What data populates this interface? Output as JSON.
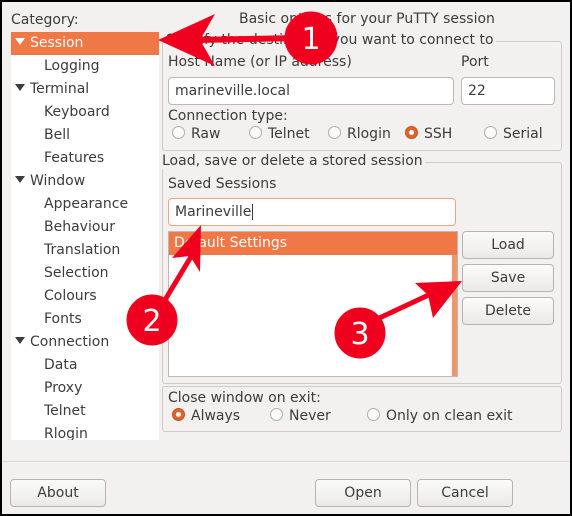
{
  "category": {
    "label": "Category:",
    "items": [
      {
        "label": "Session",
        "level": 0,
        "expanded": true,
        "selected": true
      },
      {
        "label": "Logging",
        "level": 1
      },
      {
        "label": "Terminal",
        "level": 0,
        "expanded": true
      },
      {
        "label": "Keyboard",
        "level": 1
      },
      {
        "label": "Bell",
        "level": 1
      },
      {
        "label": "Features",
        "level": 1
      },
      {
        "label": "Window",
        "level": 0,
        "expanded": true
      },
      {
        "label": "Appearance",
        "level": 1
      },
      {
        "label": "Behaviour",
        "level": 1
      },
      {
        "label": "Translation",
        "level": 1
      },
      {
        "label": "Selection",
        "level": 1
      },
      {
        "label": "Colours",
        "level": 1
      },
      {
        "label": "Fonts",
        "level": 1
      },
      {
        "label": "Connection",
        "level": 0,
        "expanded": true
      },
      {
        "label": "Data",
        "level": 1
      },
      {
        "label": "Proxy",
        "level": 1
      },
      {
        "label": "Telnet",
        "level": 1
      },
      {
        "label": "Rlogin",
        "level": 1
      }
    ]
  },
  "session": {
    "title": "Basic options for your PuTTY session",
    "destination_frame": "Specify the destination you want to connect to",
    "host_label": "Host Name (or IP address)",
    "host_value": "marineville.local",
    "port_label": "Port",
    "port_value": "22",
    "connection_type_label": "Connection type:",
    "connection_types": [
      {
        "label": "Raw",
        "checked": false
      },
      {
        "label": "Telnet",
        "checked": false
      },
      {
        "label": "Rlogin",
        "checked": false
      },
      {
        "label": "SSH",
        "checked": true
      },
      {
        "label": "Serial",
        "checked": false
      }
    ],
    "stored_frame": "Load, save or delete a stored session",
    "saved_sessions_label": "Saved Sessions",
    "saved_sessions_value": "Marineville",
    "sessions_list": [
      "Default Settings"
    ],
    "load_label": "Load",
    "save_label": "Save",
    "delete_label": "Delete",
    "close_label": "Close window on exit:",
    "close_options": [
      {
        "label": "Always",
        "checked": true
      },
      {
        "label": "Never",
        "checked": false
      },
      {
        "label": "Only on clean exit",
        "checked": false
      }
    ]
  },
  "footer": {
    "about_label": "About",
    "open_label": "Open",
    "cancel_label": "Cancel"
  },
  "annotations": {
    "color": "#f0001e",
    "badges": [
      "1",
      "2",
      "3"
    ]
  }
}
